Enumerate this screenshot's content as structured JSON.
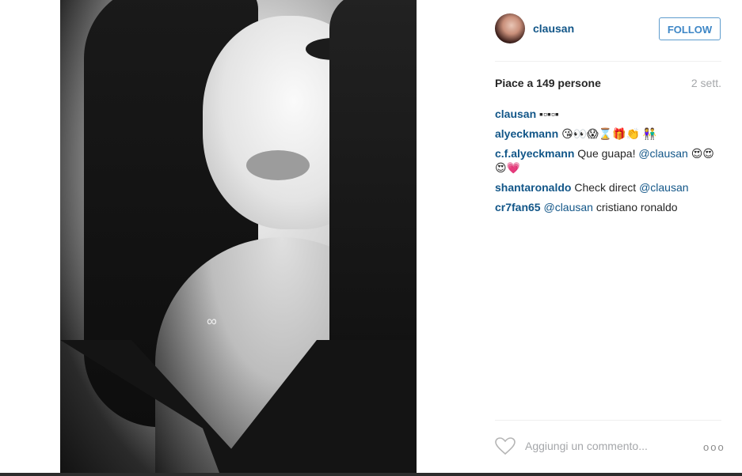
{
  "post": {
    "photo_alt": "photo",
    "username": "clausan",
    "follow_label": "FOLLOW",
    "likes_text": "Piace a 149 persone",
    "date_text": "2 sett.",
    "comments": [
      {
        "user": "clausan",
        "text": "▪▫▪▫▪",
        "mention": ""
      },
      {
        "user": "alyeckmann",
        "text": "😘👀😱⌛🎁👏   👫",
        "mention": ""
      },
      {
        "user": "c.f.alyeckmann",
        "text": "Que guapa!",
        "mention": "@clausan",
        "after": "😍😍😍💗"
      },
      {
        "user": "shantaronaldo",
        "text": "Check direct",
        "mention": "@clausan"
      },
      {
        "user": "cr7fan65",
        "text": "",
        "mention": "@clausan",
        "after": "cristiano ronaldo"
      }
    ],
    "add_comment_placeholder": "Aggiungi un commento...",
    "more_label": "ooo"
  },
  "colors": {
    "link": "#125688",
    "follow_border": "#5e9ccd",
    "muted": "#a5a7aa"
  }
}
